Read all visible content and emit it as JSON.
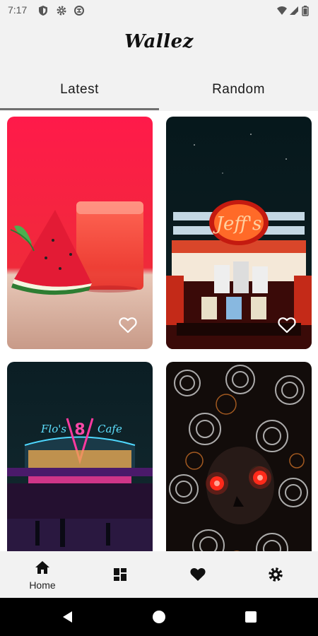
{
  "status_bar": {
    "time": "7:17",
    "icons": [
      "shield-icon",
      "gear-icon",
      "data-saver-icon",
      "wifi-icon",
      "signal-icon",
      "battery-icon"
    ]
  },
  "app": {
    "title": "Wallez"
  },
  "tabs": [
    {
      "label": "Latest",
      "selected": true
    },
    {
      "label": "Random",
      "selected": false
    }
  ],
  "wallpapers": [
    {
      "subject": "watermelon-juice",
      "favorite_icon": "heart-outline-icon"
    },
    {
      "subject": "jeffs-neon-sign",
      "favorite_icon": "heart-outline-icon"
    },
    {
      "subject": "flos-cafe",
      "favorite_icon": "heart-outline-icon"
    },
    {
      "subject": "succulent-skull",
      "favorite_icon": "heart-outline-icon"
    }
  ],
  "bottom_nav": [
    {
      "label": "Home",
      "icon": "home-icon",
      "active": true
    },
    {
      "label": "",
      "icon": "dashboard-icon",
      "active": false
    },
    {
      "label": "",
      "icon": "heart-icon",
      "active": false
    },
    {
      "label": "",
      "icon": "settings-icon",
      "active": false
    }
  ],
  "colors": {
    "background": "#f2f2f2",
    "tab_indicator": "#707070",
    "system_nav": "#000000"
  }
}
